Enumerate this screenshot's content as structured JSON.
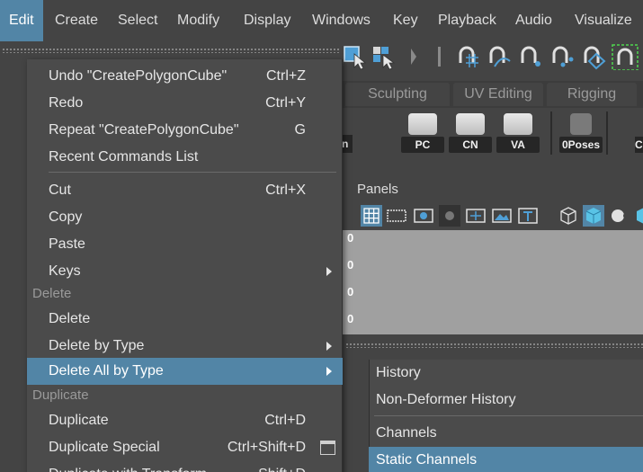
{
  "menubar": {
    "items": [
      {
        "label": "Edit",
        "active": true
      },
      {
        "label": "Create"
      },
      {
        "label": "Select"
      },
      {
        "label": "Modify"
      },
      {
        "label": "Display"
      },
      {
        "label": "Windows"
      },
      {
        "label": "Key"
      },
      {
        "label": "Playback"
      },
      {
        "label": "Audio"
      },
      {
        "label": "Visualize"
      }
    ]
  },
  "shelf": {
    "tabs": [
      "Sculpting",
      "UV Editing",
      "Rigging"
    ],
    "buttons": [
      "PC",
      "CN",
      "VA",
      "0Poses",
      "C"
    ],
    "partial_label": "n"
  },
  "panel": {
    "menu_label": "Panels",
    "hud_values": [
      "0",
      "0",
      "0",
      "0"
    ]
  },
  "edit_menu": {
    "items": [
      {
        "label": "Undo \"CreatePolygonCube\"",
        "shortcut": "Ctrl+Z"
      },
      {
        "label": "Redo",
        "shortcut": "Ctrl+Y"
      },
      {
        "label": "Repeat \"CreatePolygonCube\"",
        "shortcut": "G"
      },
      {
        "label": "Recent Commands List",
        "shortcut": ""
      },
      {
        "label": "Cut",
        "shortcut": "Ctrl+X"
      },
      {
        "label": "Copy",
        "shortcut": ""
      },
      {
        "label": "Paste",
        "shortcut": ""
      },
      {
        "label": "Keys",
        "shortcut": ""
      },
      {
        "label": "Delete",
        "shortcut": ""
      },
      {
        "label": "Delete by Type",
        "shortcut": ""
      },
      {
        "label": "Delete All by Type",
        "shortcut": ""
      },
      {
        "label": "Duplicate",
        "shortcut": "Ctrl+D"
      },
      {
        "label": "Duplicate Special",
        "shortcut": "Ctrl+Shift+D"
      },
      {
        "label": "Duplicate with Transform",
        "shortcut": "Shift+D"
      }
    ],
    "sections": {
      "delete": "Delete",
      "duplicate": "Duplicate"
    }
  },
  "submenu": {
    "items": [
      "History",
      "Non-Deformer History",
      "Channels",
      "Static Channels"
    ]
  },
  "colors": {
    "highlight": "#5285a6",
    "menu_bg": "#4b4b4b",
    "app_bg": "#444444",
    "viewport": "#a0a0a0"
  }
}
